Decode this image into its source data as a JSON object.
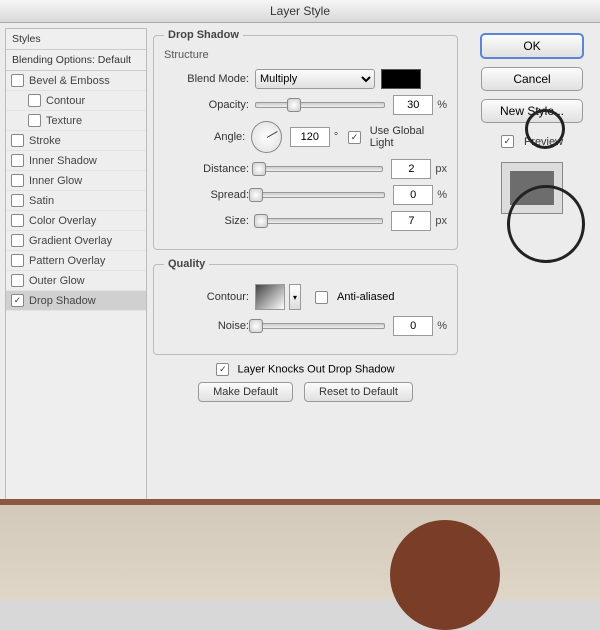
{
  "title": "Layer Style",
  "sidebar": {
    "header": "Styles",
    "blending": "Blending Options: Default",
    "items": [
      {
        "label": "Bevel & Emboss",
        "checked": false
      },
      {
        "label": "Contour",
        "checked": false,
        "sub": true
      },
      {
        "label": "Texture",
        "checked": false,
        "sub": true
      },
      {
        "label": "Stroke",
        "checked": false
      },
      {
        "label": "Inner Shadow",
        "checked": false
      },
      {
        "label": "Inner Glow",
        "checked": false
      },
      {
        "label": "Satin",
        "checked": false
      },
      {
        "label": "Color Overlay",
        "checked": false
      },
      {
        "label": "Gradient Overlay",
        "checked": false
      },
      {
        "label": "Pattern Overlay",
        "checked": false
      },
      {
        "label": "Outer Glow",
        "checked": false
      },
      {
        "label": "Drop Shadow",
        "checked": true,
        "active": true
      }
    ]
  },
  "panel": {
    "title": "Drop Shadow",
    "structure_label": "Structure",
    "quality_label": "Quality",
    "blend_mode_label": "Blend Mode:",
    "blend_mode_value": "Multiply",
    "opacity_label": "Opacity:",
    "opacity_value": "30",
    "opacity_unit": "%",
    "angle_label": "Angle:",
    "angle_value": "120",
    "angle_unit": "°",
    "global_light": "Use Global Light",
    "distance_label": "Distance:",
    "distance_value": "2",
    "distance_unit": "px",
    "spread_label": "Spread:",
    "spread_value": "0",
    "spread_unit": "%",
    "size_label": "Size:",
    "size_value": "7",
    "size_unit": "px",
    "contour_label": "Contour:",
    "anti_aliased": "Anti-aliased",
    "noise_label": "Noise:",
    "noise_value": "0",
    "noise_unit": "%",
    "knock_label": "Layer Knocks Out Drop Shadow",
    "make_default": "Make Default",
    "reset_default": "Reset to Default"
  },
  "right": {
    "ok": "OK",
    "cancel": "Cancel",
    "new_style": "New Style...",
    "preview": "Preview"
  }
}
